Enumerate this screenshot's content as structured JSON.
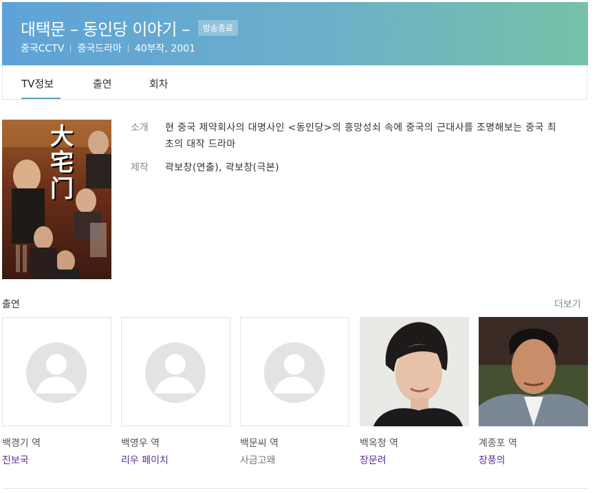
{
  "header": {
    "title": "대택문 – 동인당 이야기 –",
    "badge": "방송종료",
    "meta": [
      "중국CCTV",
      "중국드라마",
      "40부작, 2001"
    ]
  },
  "tabs": [
    {
      "label": "TV정보",
      "active": true
    },
    {
      "label": "출연",
      "active": false
    },
    {
      "label": "회차",
      "active": false
    }
  ],
  "info": {
    "intro_label": "소개",
    "intro_value": "현 중국 제약회사의 대명사인 <동인당>의 흥망성쇠 속에 중국의 근대사를 조명해보는 중국 최초의 대작 드라마",
    "production_label": "제작",
    "production_value": "곽보창(연출), 곽보창(극본)"
  },
  "poster": {
    "title_glyphs": "大宅门"
  },
  "cast": {
    "title": "출연",
    "more_label": "더보기",
    "members": [
      {
        "role": "백경기 역",
        "name": "진보국",
        "has_photo": false,
        "linked": true
      },
      {
        "role": "백영우 역",
        "name": "리우 페이치",
        "has_photo": false,
        "linked": true
      },
      {
        "role": "백문씨 역",
        "name": "사금고왜",
        "has_photo": false,
        "linked": false
      },
      {
        "role": "백옥정 역",
        "name": "장문려",
        "has_photo": true,
        "linked": true
      },
      {
        "role": "계종포 역",
        "name": "장풍의",
        "has_photo": true,
        "linked": true
      }
    ]
  },
  "colors": {
    "header_start": "#5fa2d8",
    "header_end": "#76c2a8",
    "tab_accent": "#5aa3c8",
    "link": "#5b2f9e"
  }
}
